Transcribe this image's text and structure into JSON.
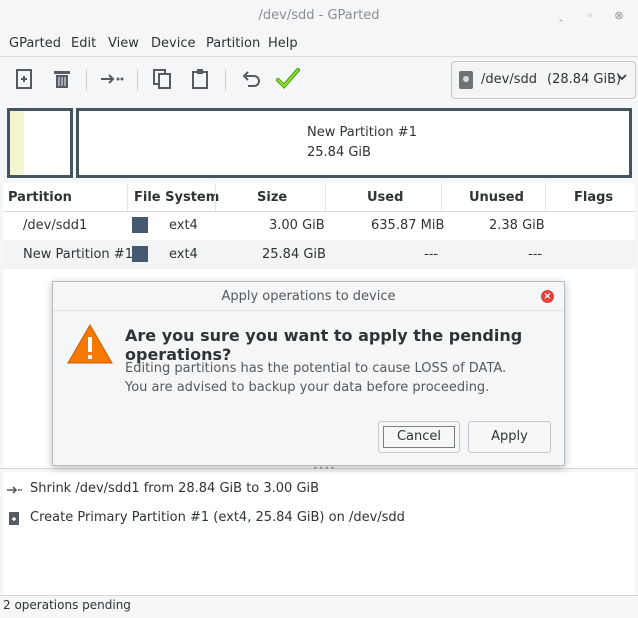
{
  "window": {
    "title": "/dev/sdd - GParted",
    "minimize": "‸",
    "restore": "◦",
    "close": "⊗"
  },
  "menu": [
    "GParted",
    "Edit",
    "View",
    "Device",
    "Partition",
    "Help"
  ],
  "toolbar": {
    "icons": [
      "new-partition-icon",
      "delete-icon",
      "resize-move-icon",
      "copy-icon",
      "paste-icon",
      "undo-icon",
      "apply-icon"
    ],
    "device_selector": {
      "device": "/dev/sdd",
      "size": "(28.84 GiB)"
    }
  },
  "disk_map": {
    "partitions": [
      {
        "name": "",
        "color": "#f5f5cf"
      },
      {
        "name": "New Partition #1",
        "size": "25.84 GiB"
      }
    ]
  },
  "table": {
    "columns": [
      "Partition",
      "File System",
      "Size",
      "Used",
      "Unused",
      "Flags"
    ],
    "rows": [
      {
        "partition": "/dev/sdd1",
        "fs": "ext4",
        "size": "3.00 GiB",
        "used": "635.87 MiB",
        "unused": "2.38 GiB",
        "flags": "",
        "swatch": "#455a70"
      },
      {
        "partition": "New Partition #1",
        "fs": "ext4",
        "size": "25.84 GiB",
        "used": "---",
        "unused": "---",
        "flags": "",
        "swatch": "#455a70"
      }
    ]
  },
  "dialog": {
    "title": "Apply operations to device",
    "heading": "Are you sure you want to apply the pending operations?",
    "line1": "Editing partitions has the potential to cause LOSS of DATA.",
    "line2": "You are advised to backup your data before proceeding.",
    "cancel": "Cancel",
    "apply": "Apply",
    "warning_color": "#f57900"
  },
  "operations": [
    {
      "icon": "shrink-icon",
      "text": "Shrink /dev/sdd1 from 28.84 GiB to 3.00 GiB"
    },
    {
      "icon": "create-partition-icon",
      "text": "Create Primary Partition #1 (ext4, 25.84 GiB) on /dev/sdd"
    }
  ],
  "status": "2 operations pending"
}
